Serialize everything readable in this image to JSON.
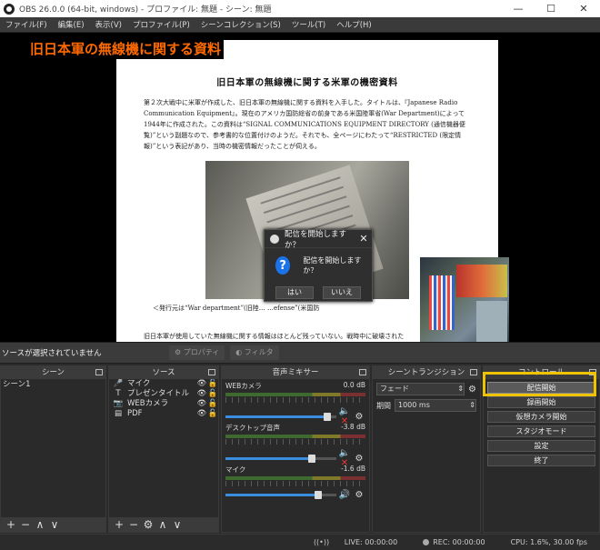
{
  "window": {
    "title": "OBS 26.0.0 (64-bit, windows) - プロファイル: 無題 - シーン: 無題",
    "minimize": "—",
    "maximize": "☐",
    "close": "✕"
  },
  "menu": [
    "ファイル(F)",
    "編集(E)",
    "表示(V)",
    "プロファイル(P)",
    "シーンコレクション(S)",
    "ツール(T)",
    "ヘルプ(H)"
  ],
  "preview": {
    "slide_title": "旧日本軍の無線機に関する資料",
    "doc_heading": "旧日本軍の無線機に関する米軍の機密資料",
    "doc_paragraph": "第２次大戦中に米軍が作成した、旧日本軍の無線機に関する資料を入手した。タイトルは、『Japanese Radio Communication Equipment』。現在のアメリカ国防総省の前身である米国陸軍省(War Department)によって1944年に作成された。この資料は“SIGNAL COMMUNICATIONS EQUIPMENT DIRECTORY (通信機器便覧)”という副題なので、参考書的な位置付けのようだ。それでも、全ページにわたって“RESTRICTED (限定情報)”という表記があり、当時の機密情報だったことが伺える。",
    "caption": "＜発行元は“War department”(旧陸…                        …efense”(米国防",
    "doc_paragraph2": "旧日本軍が使用していた無線機に関する情報はほとんど残っていない。戦時中に破壊された"
  },
  "dialog": {
    "title": "配信を開始しますか？",
    "message": "配信を開始しますか？",
    "yes": "はい",
    "no": "いいえ",
    "close": "✕",
    "icon": "?"
  },
  "source_toolbar": {
    "no_source": "ソースが選択されていません",
    "properties": "⚙ プロパティ",
    "filters": "◐ フィルタ"
  },
  "scenes": {
    "title": "シーン",
    "items": [
      "シーン1"
    ]
  },
  "sources": {
    "title": "ソース",
    "items": [
      {
        "icon": "🎤",
        "name": "マイク"
      },
      {
        "icon": "T",
        "name": "プレゼンタイトル"
      },
      {
        "icon": "📷",
        "name": "WEBカメラ"
      },
      {
        "icon": "▤",
        "name": "PDF"
      }
    ]
  },
  "mixer": {
    "title": "音声ミキサー",
    "channels": [
      {
        "name": "WEBカメラ",
        "db": "0.0 dB",
        "level": 0.92,
        "muted": true
      },
      {
        "name": "デスクトップ音声",
        "db": "-3.8 dB",
        "level": 0.78,
        "muted": true
      },
      {
        "name": "マイク",
        "db": "-1.6 dB",
        "level": 0.84,
        "muted": false
      }
    ]
  },
  "transitions": {
    "title": "シーントランジション",
    "selected": "フェード",
    "duration_label": "期間",
    "duration": "1000 ms"
  },
  "controls": {
    "title": "コントロール",
    "buttons": [
      "配信開始",
      "録画開始",
      "仮想カメラ開始",
      "スタジオモード",
      "設定",
      "終了"
    ]
  },
  "status": {
    "live": "LIVE: 00:00:00",
    "rec": "REC: 00:00:00",
    "cpu": "CPU: 1.6%, 30.00 fps"
  },
  "colors": {
    "accent": "#f0c300",
    "title_orange": "#ff6a00",
    "blue": "#3b8de0"
  }
}
